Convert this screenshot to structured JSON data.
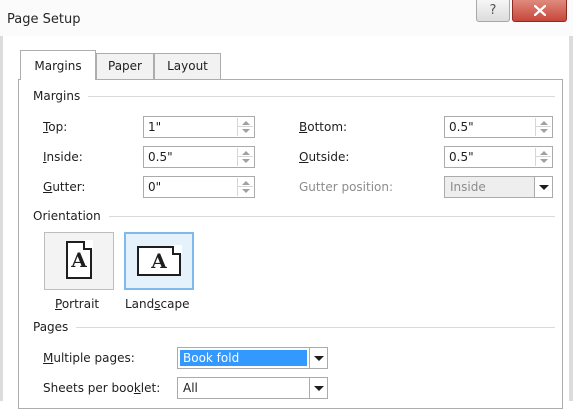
{
  "window": {
    "title": "Page Setup",
    "help_glyph": "?",
    "close_glyph": "X"
  },
  "tabs": [
    {
      "label": "Margins",
      "active": true
    },
    {
      "label": "Paper",
      "active": false
    },
    {
      "label": "Layout",
      "active": false
    }
  ],
  "margins": {
    "group_label": "Margins",
    "top": {
      "mnemonic": "T",
      "rest": "op:",
      "value": "1\""
    },
    "inside": {
      "mnemonic": "I",
      "rest": "nside:",
      "value": "0.5\""
    },
    "gutter": {
      "mnemonic": "G",
      "rest": "utter:",
      "value": "0\""
    },
    "bottom": {
      "mnemonic": "B",
      "rest": "ottom:",
      "value": "0.5\""
    },
    "outside": {
      "mnemonic": "O",
      "rest": "utside:",
      "value": "0.5\""
    },
    "gutter_position": {
      "label": "Gutter position:",
      "value": "Inside",
      "disabled": true
    }
  },
  "orientation": {
    "group_label": "Orientation",
    "icon_glyph": "A",
    "portrait": {
      "mnemonic": "P",
      "rest": "ortrait",
      "selected": false
    },
    "landscape": {
      "before": "Land",
      "mnemonic": "s",
      "rest": "cape",
      "selected": true
    }
  },
  "pages": {
    "group_label": "Pages",
    "multiple_pages": {
      "mnemonic": "M",
      "rest": "ultiple pages:",
      "value": "Book fold"
    },
    "sheets_per_booklet": {
      "before": "Sheets per boo",
      "mnemonic": "k",
      "rest": "let:",
      "value": "All"
    }
  },
  "colors": {
    "selection": "#3399ff",
    "close_button": "#c7463a",
    "selected_orientation_border": "#80b9ee"
  }
}
